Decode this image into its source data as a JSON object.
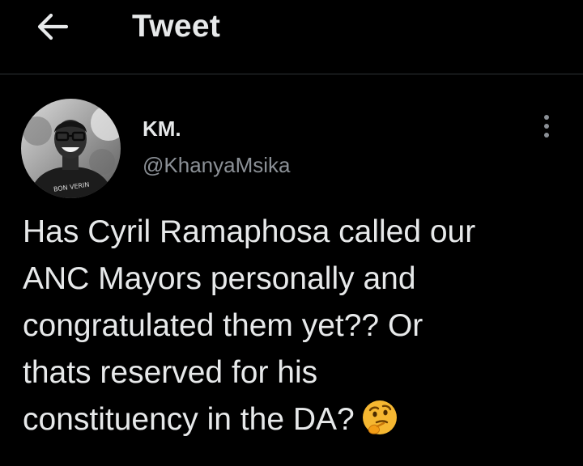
{
  "header": {
    "back_icon": "arrow-left-icon",
    "title": "Tweet"
  },
  "tweet": {
    "author": {
      "display_name": "KM.",
      "handle": "@KhanyaMsika",
      "avatar_shirt_text": "BON VERIN"
    },
    "more_icon": "more-vertical-icon",
    "text_lines": [
      "Has Cyril Ramaphosa called our",
      "ANC Mayors personally and",
      "congratulated them yet?? Or",
      "thats reserved for his",
      "constituency in the DA?"
    ],
    "emoji": "thinking-face-emoji"
  },
  "colors": {
    "background": "#000000",
    "primary_text": "#e7e9ea",
    "secondary_text": "#8b9096",
    "divider": "#2f3336"
  }
}
